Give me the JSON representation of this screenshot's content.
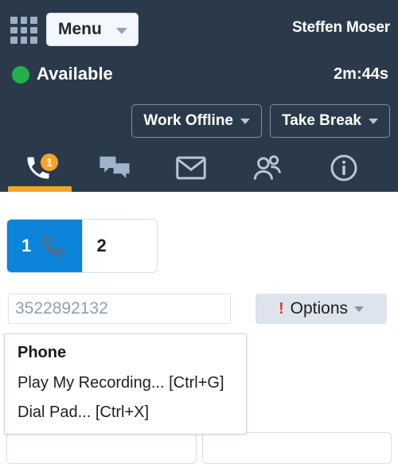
{
  "header": {
    "grid_icon": "app-grid-icon",
    "menu_label": "Menu",
    "agent_name": "Steffen Moser",
    "status": {
      "label": "Available",
      "dot_color": "#22b14c"
    },
    "timer": "2m:44s",
    "state_buttons": [
      {
        "label": "Work Offline",
        "icon": "chevron-down-icon"
      },
      {
        "label": "Take Break",
        "icon": "chevron-down-icon"
      }
    ],
    "icon_tabs": [
      {
        "name": "phone-icon",
        "badge": "1",
        "active": true
      },
      {
        "name": "chat-icon",
        "badge": "",
        "active": false
      },
      {
        "name": "email-icon",
        "badge": "",
        "active": false
      },
      {
        "name": "contacts-icon",
        "badge": "",
        "active": false
      },
      {
        "name": "info-icon",
        "badge": "",
        "active": false
      }
    ],
    "active_accent": "#f5a32a",
    "background": "#2b3a4a"
  },
  "main": {
    "line_tabs": [
      {
        "number": "1",
        "icon": "phone-icon",
        "selected": true
      },
      {
        "number": "2",
        "icon": "",
        "selected": false
      }
    ],
    "selected_color": "#0b84d9",
    "dial": {
      "value": "3522892132",
      "placeholder": "3522892132"
    },
    "options_button": {
      "alert_glyph": "!",
      "label": "Options",
      "caret": "chevron-down-icon",
      "alert_color": "#e03b2f"
    },
    "dropdown": {
      "header": "Phone",
      "items": [
        "Play My Recording... [Ctrl+G]",
        "Dial Pad... [Ctrl+X]"
      ]
    },
    "footer_buttons": [
      "",
      ""
    ]
  }
}
